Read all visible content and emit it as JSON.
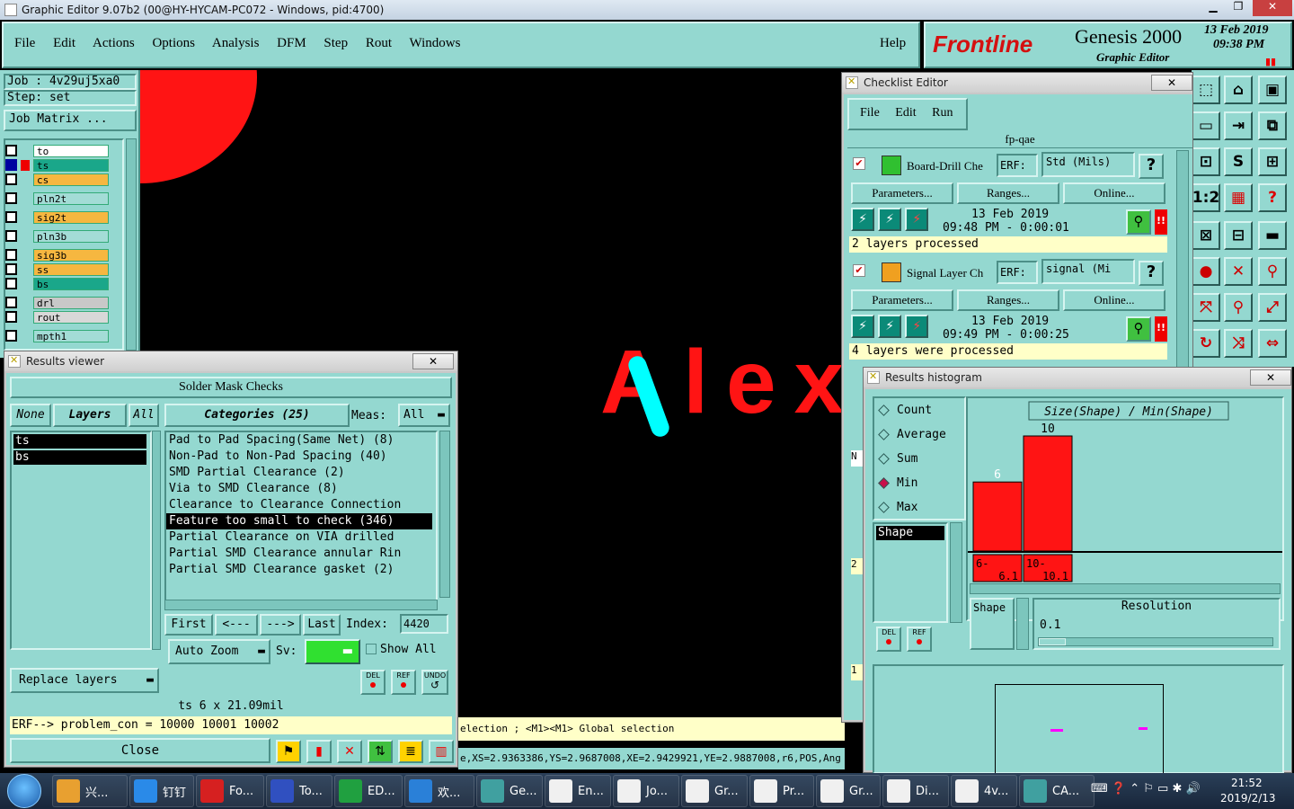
{
  "window": {
    "title": "Graphic Editor 9.07b2 (00@HY-HYCAM-PC072 - Windows, pid:4700)"
  },
  "menubar": {
    "items": [
      "File",
      "Edit",
      "Actions",
      "Options",
      "Analysis",
      "DFM",
      "Step",
      "Rout",
      "Windows"
    ],
    "help": "Help"
  },
  "brand": {
    "logo": "Frontline",
    "product": "Genesis 2000",
    "subtitle": "Graphic Editor",
    "date": "13 Feb 2019",
    "time": "09:38 PM"
  },
  "job": {
    "job_label": "Job : 4v29uj5xa0",
    "step_label": "Step: set",
    "matrix_button": "Job Matrix ..."
  },
  "layers": [
    {
      "name": "to",
      "color": "#ffffff"
    },
    {
      "name": "ts",
      "color": "#1aa78a"
    },
    {
      "name": "cs",
      "color": "#f6b740"
    },
    {
      "name": "pln2t",
      "color": "#a3dcd6"
    },
    {
      "name": "sig2t",
      "color": "#f6b740"
    },
    {
      "name": "pln3b",
      "color": "#a3dcd6"
    },
    {
      "name": "sig3b",
      "color": "#f6b740"
    },
    {
      "name": "ss",
      "color": "#f6b740"
    },
    {
      "name": "bs",
      "color": "#1aa78a"
    },
    {
      "name": "drl",
      "color": "#c8c8c8"
    },
    {
      "name": "rout",
      "color": "#d8d8d8"
    },
    {
      "name": "mpth1",
      "color": "#a3dcd6"
    }
  ],
  "canvas": {
    "text": "Alex",
    "status1": "election ; <M1><M1> Global selection",
    "status2": "e,XS=2.9363386,YS=2.9687008,XE=2.9429921,YE=2.9887008,r6,POS,Ang"
  },
  "results_viewer": {
    "title": "Results viewer",
    "header": "Solder Mask Checks",
    "none_btn": "None",
    "layers_btn": "Layers",
    "all_btn": "All",
    "categories_btn": "Categories (25)",
    "meas_label": "Meas:",
    "meas_value": "All",
    "layer_list": [
      "ts",
      "bs"
    ],
    "categories": [
      "Pad to Pad Spacing(Same Net) (8)",
      "Non-Pad to Non-Pad Spacing (40)",
      "SMD Partial Clearance (2)",
      "Via to SMD Clearance (8)",
      "Clearance to Clearance Connection",
      "Feature too small to check (346)",
      "Partial Clearance on VIA drilled",
      "Partial SMD Clearance annular Rin",
      "Partial SMD Clearance gasket (2)"
    ],
    "selected_category": 5,
    "nav": {
      "first": "First",
      "prev": "<---",
      "next": "--->",
      "last": "Last",
      "index_label": "Index:",
      "index_value": "4420"
    },
    "auto_zoom": "Auto Zoom",
    "sv_label": "Sv:",
    "show_all": "Show All",
    "replace_layers": "Replace layers",
    "icons": {
      "del": "DEL",
      "ref": "REF",
      "undo": "UNDO"
    },
    "info": "ts 6 x 21.09mil",
    "erf": "ERF--> problem_con = 10000 10001 10002",
    "close": "Close"
  },
  "checklist": {
    "title": "Checklist Editor",
    "menu": [
      "File",
      "Edit",
      "Run"
    ],
    "name": "fp-qae",
    "checks": [
      {
        "name": "Board-Drill Che",
        "erf_label": "ERF:",
        "erf_value": "Std (Mils)",
        "params": "Parameters...",
        "ranges": "Ranges...",
        "online": "Online...",
        "date": "13 Feb 2019",
        "time": "09:48 PM - 0:00:01",
        "status": "2 layers processed"
      },
      {
        "name": "Signal Layer Ch",
        "erf_label": "ERF:",
        "erf_value": "signal (Mi",
        "params": "Parameters...",
        "ranges": "Ranges...",
        "online": "Online...",
        "date": "13 Feb 2019",
        "time": "09:49 PM - 0:00:25",
        "status": "4 layers were processed"
      }
    ],
    "side_chars": [
      "N",
      "2",
      "1"
    ]
  },
  "histogram": {
    "title": "Results histogram",
    "options": [
      "Count",
      "Average",
      "Sum",
      "Min",
      "Max"
    ],
    "selected_option": "Min",
    "list_item": "Shape",
    "chart_title": "Size(Shape) / Min(Shape)",
    "resolution_label": "Resolution",
    "resolution_value": "0.1",
    "shape_tab": "Shape",
    "icons": {
      "del": "DEL",
      "ref": "REF"
    }
  },
  "chart_data": {
    "type": "bar",
    "title": "Size(Shape) / Min(Shape)",
    "categories": [
      "6-6.1",
      "10-10.1"
    ],
    "category_labels": [
      {
        "top": "6-",
        "bottom": "6.1"
      },
      {
        "top": "10-",
        "bottom": "10.1"
      }
    ],
    "values": [
      6,
      10
    ],
    "ylim": [
      0,
      10
    ]
  },
  "taskbar": {
    "items": [
      {
        "label": "兴...",
        "color": "#e8a030"
      },
      {
        "label": "钉钉",
        "color": "#2a8ae8"
      },
      {
        "label": "Fo...",
        "color": "#d62020"
      },
      {
        "label": "To...",
        "color": "#3050c0"
      },
      {
        "label": "ED...",
        "color": "#20a040"
      },
      {
        "label": "欢...",
        "color": "#2a80d8"
      },
      {
        "label": "Ge...",
        "color": "#40a0a0"
      },
      {
        "label": "En...",
        "color": "#f0f0f0"
      },
      {
        "label": "Jo...",
        "color": "#f0f0f0"
      },
      {
        "label": "Gr...",
        "color": "#f0f0f0"
      },
      {
        "label": "Pr...",
        "color": "#f0f0f0"
      },
      {
        "label": "Gr...",
        "color": "#f0f0f0"
      },
      {
        "label": "Di...",
        "color": "#f0f0f0"
      },
      {
        "label": "4v...",
        "color": "#f0f0f0"
      },
      {
        "label": "CA...",
        "color": "#40a0a0"
      }
    ],
    "time": "21:52",
    "date": "2019/2/13"
  },
  "toolbar_icons": [
    "⬚",
    "⌂",
    "▣",
    "▭",
    "⇥",
    "⧉",
    "⊡",
    "S",
    "⊞",
    "1:2",
    "▦",
    "?",
    "⊠",
    "⊟",
    "▬",
    "●",
    "✕",
    "⚲",
    "⤧",
    "⚲",
    "⤢",
    "↻",
    "⤨",
    "⇔",
    "⊕",
    "⊞"
  ],
  "colors": {
    "teal": "#94d8d0",
    "red": "#ff1414",
    "cyan": "#00ffff",
    "yellow_bg": "#ffffc8"
  }
}
